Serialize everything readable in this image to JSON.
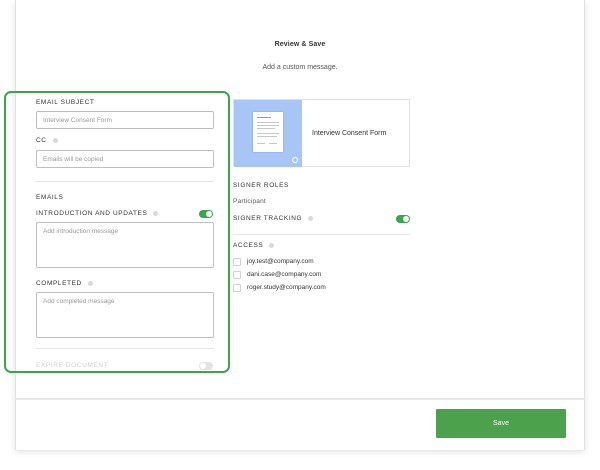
{
  "header": {
    "title": "Review & Save",
    "subtitle": "Add a custom message."
  },
  "left": {
    "email_subject": {
      "label": "EMAIL SUBJECT",
      "placeholder": "Interview Consent Form"
    },
    "cc": {
      "label": "CC",
      "placeholder": "Emails will be copied"
    },
    "emails_heading": "EMAILS",
    "introduction": {
      "label": "INTRODUCTION AND UPDATES",
      "placeholder": "Add introduction message",
      "toggle": "on"
    },
    "completed": {
      "label": "COMPLETED",
      "placeholder": "Add completed message"
    },
    "expire": {
      "label": "EXPIRE DOCUMENT",
      "toggle": "off"
    }
  },
  "right": {
    "document": {
      "name": "Interview Consent Form",
      "thumbnail_color": "#a7c6f5"
    },
    "signer_roles": {
      "label": "SIGNER ROLES",
      "value": "Participant"
    },
    "signer_tracking": {
      "label": "SIGNER TRACKING",
      "toggle": "on"
    },
    "access": {
      "label": "ACCESS",
      "emails": [
        "joy.test@company.com",
        "dani.case@company.com",
        "roger.study@company.com"
      ]
    }
  },
  "footer": {
    "save_label": "Save",
    "save_color": "#4ca14d"
  },
  "colors": {
    "accent_green": "#3aa54a",
    "highlight_border": "#3aa54a"
  }
}
